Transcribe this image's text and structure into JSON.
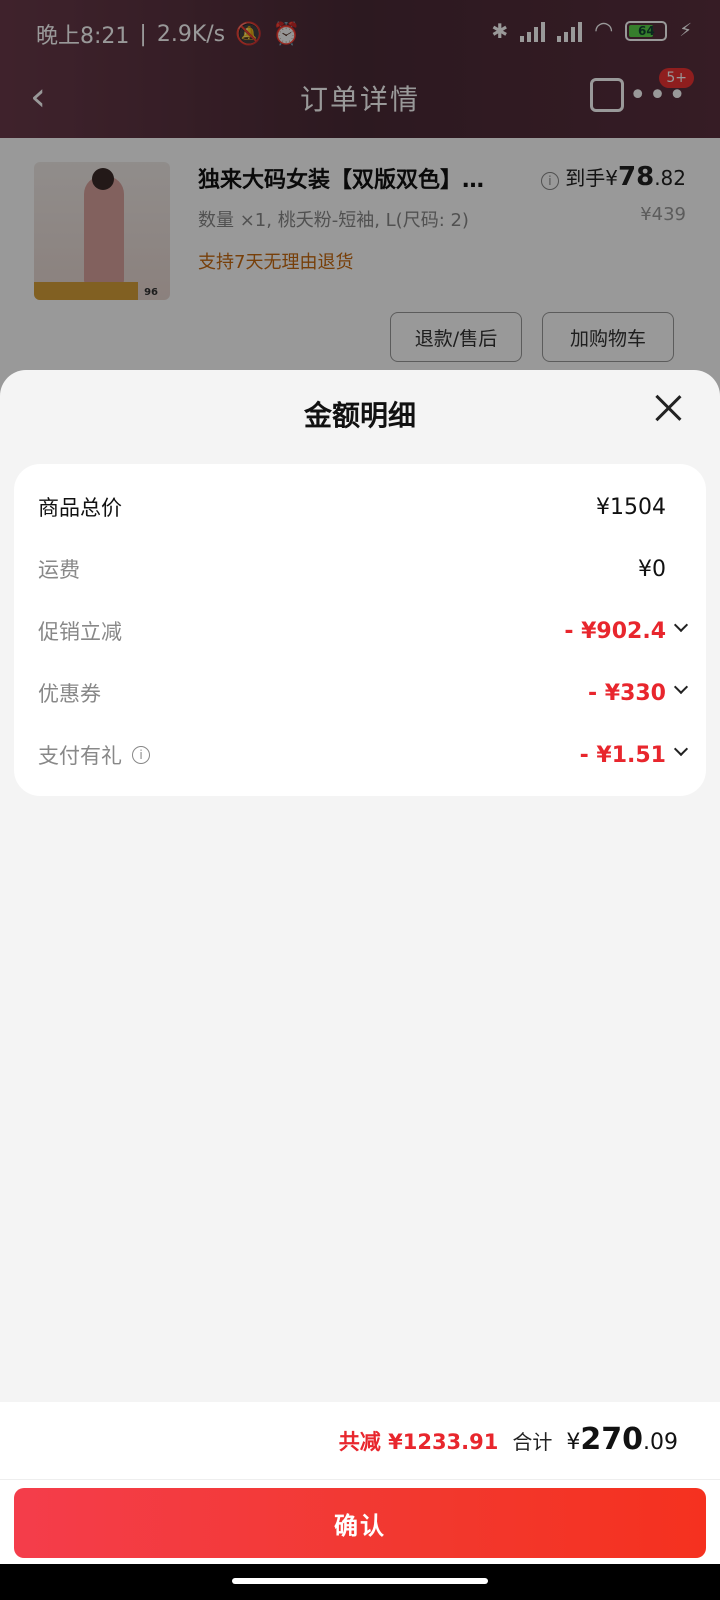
{
  "status_bar": {
    "time": "晚上8:21",
    "speed": "2.9K/s",
    "battery": "64"
  },
  "nav": {
    "title": "订单详情",
    "more_badge": "5+"
  },
  "product": {
    "title": "独来大码女装【双版双色】…",
    "spec": "数量 ×1, 桃夭粉-短袖, L(尺码: 2)",
    "policy": "支持7天无理由退货",
    "price_prefix": "到手¥",
    "price_int": "78",
    "price_dec": ".82",
    "original_price": "¥439",
    "thumb_number": "96"
  },
  "order_actions": {
    "refund_label": "退款/售后",
    "add_cart_label": "加购物车"
  },
  "sheet": {
    "title": "金额明细",
    "rows": [
      {
        "label": "商品总价",
        "value": "¥1504"
      },
      {
        "label": "运费",
        "value": "¥0"
      },
      {
        "label": "促销立减",
        "value": "- ¥902.4"
      },
      {
        "label": "优惠券",
        "value": "- ¥330"
      },
      {
        "label": "支付有礼",
        "value": "- ¥1.51"
      }
    ]
  },
  "footer": {
    "saved_label": "共减",
    "saved_value": "¥1233.91",
    "total_label": "合计",
    "total_currency": "¥",
    "total_int": "270",
    "total_dec": ".09",
    "confirm_label": "确认"
  },
  "colors": {
    "accent_red": "#e8262d",
    "policy_orange": "#c76a10"
  }
}
